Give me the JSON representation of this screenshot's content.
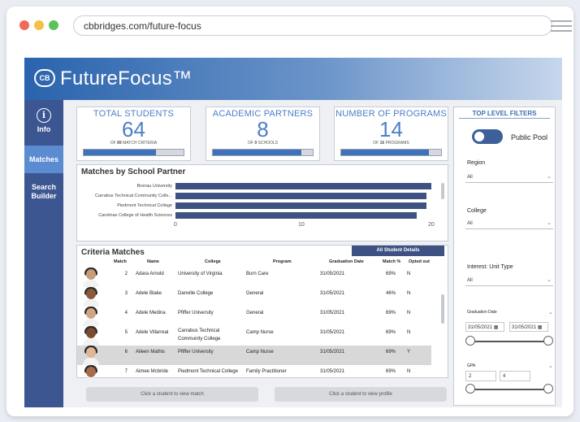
{
  "browser": {
    "url": "cbbridges.com/future-focus",
    "dot_colors": [
      "#f06a5a",
      "#f5c04a",
      "#5cc25a"
    ]
  },
  "header": {
    "logo_text": "CB",
    "title": "FutureFocus™"
  },
  "sidebar": {
    "items": [
      {
        "label": "Info",
        "icon": "info-icon"
      },
      {
        "label": "Matches"
      },
      {
        "label": "Search Builder"
      }
    ]
  },
  "kpis": [
    {
      "title": "TOTAL STUDENTS",
      "value": "64",
      "sub_prefix": "OF",
      "sub_num": "89",
      "sub_suffix": "MATCH CRITERIA",
      "fill": 0.72
    },
    {
      "title": "ACADEMIC PARTNERS",
      "value": "8",
      "sub_prefix": "OF",
      "sub_num": "9",
      "sub_suffix": "SCHOOLS",
      "fill": 0.89
    },
    {
      "title": "NUMBER OF PROGRAMS",
      "value": "14",
      "sub_prefix": "OF",
      "sub_num": "16",
      "sub_suffix": "PROGRAMS",
      "fill": 0.875
    }
  ],
  "school_chart": {
    "title": "Matches by School Partner",
    "chart_data": {
      "type": "bar",
      "categories": [
        "Brenau University",
        "Carrabus Technical Community Colle...",
        "Piedmont Technical College",
        "Carolinas College of Health Sciences"
      ],
      "values": [
        20.7,
        20.3,
        20.3,
        19.5
      ],
      "xlim": [
        0,
        21
      ],
      "ticks": [
        "0",
        "10",
        "20"
      ]
    }
  },
  "criteria": {
    "title": "Criteria Matches",
    "tab_label": "All Student Details",
    "columns": [
      "Match",
      "Name",
      "College",
      "Program",
      "Graduation Date",
      "Match %",
      "Opted out"
    ],
    "rows": [
      {
        "match": "2",
        "name": "Adara Arnold",
        "college": "University of Virginia",
        "college2": "",
        "program": "Burn Care",
        "grad": "31/05/2021",
        "pct": "69%",
        "opted": "N"
      },
      {
        "match": "3",
        "name": "Adele Blake",
        "college": "Danville College",
        "college2": "",
        "program": "General",
        "grad": "31/05/2021",
        "pct": "46%",
        "opted": "N"
      },
      {
        "match": "4",
        "name": "Adele Medina",
        "college": "Pfiffer University",
        "college2": "",
        "program": "General",
        "grad": "31/05/2021",
        "pct": "69%",
        "opted": "N"
      },
      {
        "match": "5",
        "name": "Adele Villarreal",
        "college": "Carrabus Technical",
        "college2": "Community College",
        "program": "Camp Nurse",
        "grad": "31/05/2021",
        "pct": "69%",
        "opted": "N"
      },
      {
        "match": "6",
        "name": "Aileen Mathis",
        "college": "Pfiffer University",
        "college2": "",
        "program": "Camp Nurse",
        "grad": "31/05/2021",
        "pct": "69%",
        "opted": "Y"
      },
      {
        "match": "7",
        "name": "Aimee Mcbride",
        "college": "Piedmont Technical College",
        "college2": "",
        "program": "Family Practitioner",
        "grad": "31/05/2021",
        "pct": "69%",
        "opted": "N"
      }
    ]
  },
  "buttons": {
    "view_match": "Click a student to view match",
    "view_profile": "Click a student to view profile"
  },
  "filters": {
    "title": "TOP LEVEL FILTERS",
    "toggle_label": "Public Pool",
    "region_label": "Region",
    "region_value": "All",
    "college_label": "College",
    "college_value": "All",
    "interest_label": "Interest: Unit Type",
    "interest_value": "All",
    "grad_label": "Graduation Date",
    "grad_from": "31/05/2021",
    "grad_to": "31/05/2021",
    "gpa_label": "GPA",
    "gpa_min": "2",
    "gpa_max": "4"
  }
}
